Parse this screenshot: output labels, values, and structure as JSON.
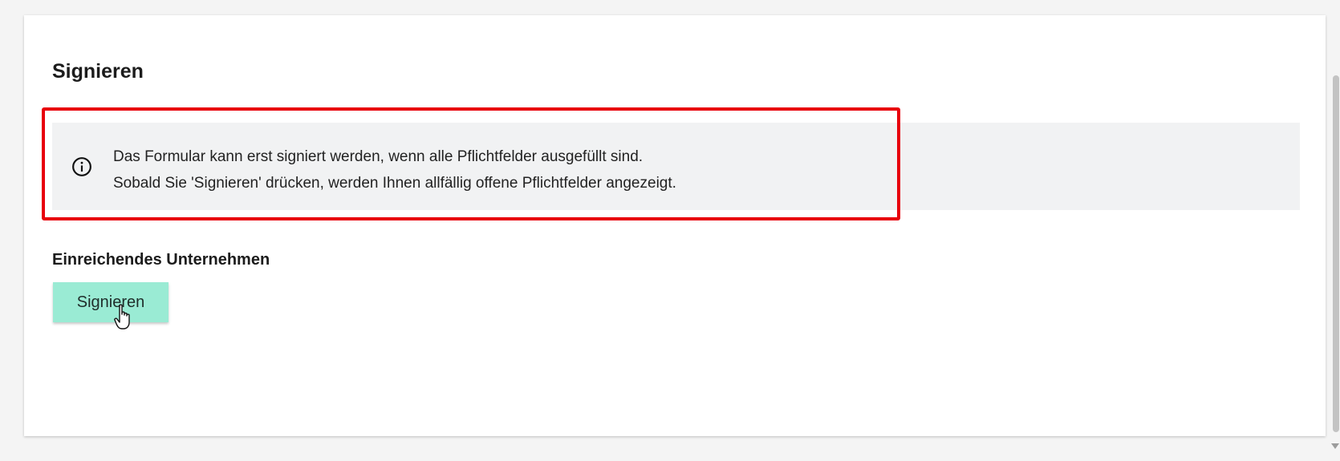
{
  "card": {
    "title": "Signieren",
    "info_icon": "info-circle-icon",
    "info_lines": [
      "Das Formular kann erst signiert werden, wenn alle Pflichtfelder ausgefüllt sind.",
      "Sobald Sie 'Signieren' drücken, werden Ihnen allfällig offene Pflichtfelder angezeigt."
    ],
    "section_label": "Einreichendes Unternehmen",
    "sign_button_label": "Signieren"
  },
  "cursor_icon": "hand-pointer-icon",
  "colors": {
    "button_bg": "#9aebd4",
    "info_bg": "#f1f2f3",
    "highlight_border": "#e8000b"
  }
}
